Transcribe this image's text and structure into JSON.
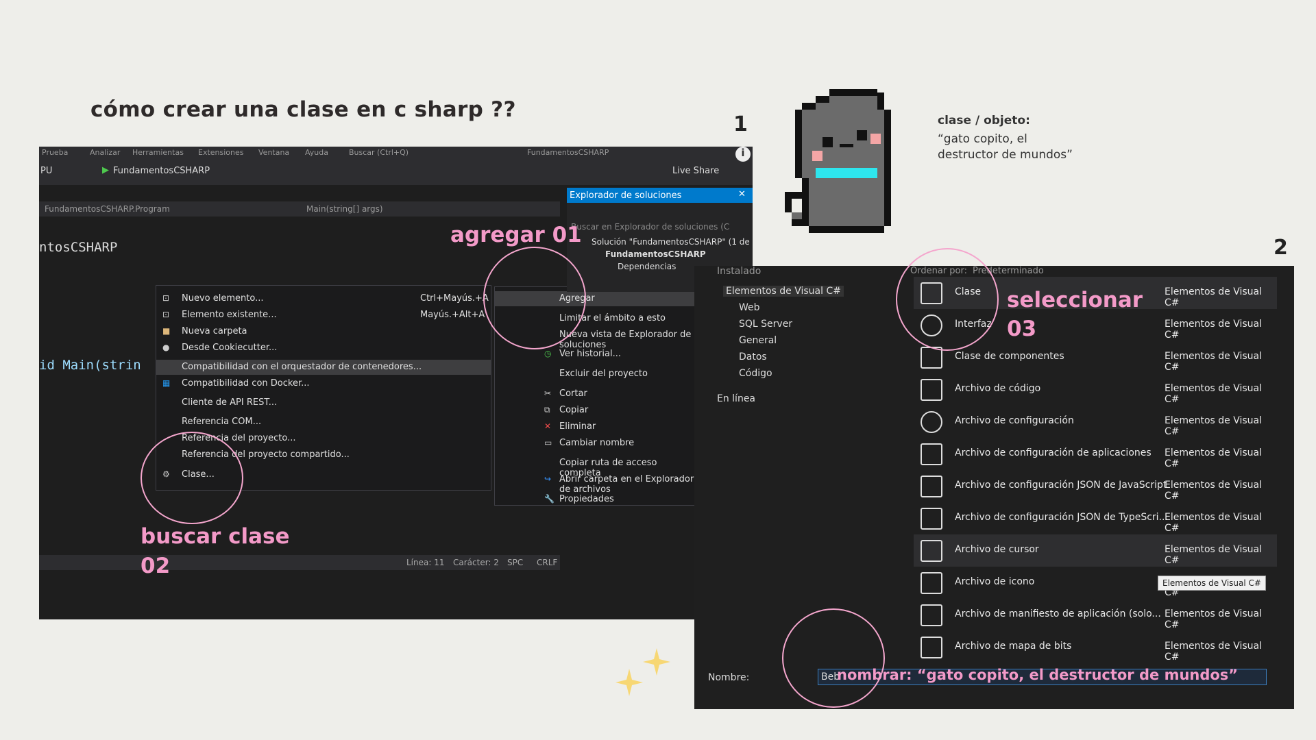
{
  "title": "cómo crear una clase en c sharp ??",
  "step1": "1",
  "step2": "2",
  "annotations": {
    "agregar": "agregar 01",
    "buscar_line1": "buscar clase",
    "buscar_line2": "02",
    "seleccionar_line1": "seleccionar",
    "seleccionar_line2": "03",
    "nombrar": "nombrar: “gato copito, el destructor de mundos”"
  },
  "note": {
    "heading": "clase / objeto:",
    "line1": "“gato copito, el",
    "line2": "destructor de mundos”"
  },
  "shot1": {
    "menu": [
      "Prueba",
      "Analizar",
      "Herramientas",
      "Extensiones",
      "Ventana",
      "Ayuda",
      "Buscar (Ctrl+Q)",
      "FundamentosCSHARP"
    ],
    "toolbar": {
      "cpu": "PU",
      "run_label": "FundamentosCSHARP",
      "live_share": "Live Share"
    },
    "nav_left": "FundamentosCSHARP.Program",
    "nav_right": "Main(string[] args)",
    "code_line1": "ntosCSHARP",
    "code_line2": "id Main(strin",
    "sub_menu": [
      {
        "label": "Nuevo elemento...",
        "shortcut": "Ctrl+Mayús.+A",
        "icon": "new-item-icon"
      },
      {
        "label": "Elemento existente...",
        "shortcut": "Mayús.+Alt+A",
        "icon": "existing-item-icon"
      },
      {
        "label": "Nueva carpeta",
        "shortcut": "",
        "icon": "folder-icon"
      },
      {
        "label": "Desde Cookiecutter...",
        "shortcut": "",
        "icon": "cookie-icon"
      },
      {
        "label": "Compatibilidad con el orquestador de contenedores...",
        "shortcut": "",
        "icon": ""
      },
      {
        "label": "Compatibilidad con Docker...",
        "shortcut": "",
        "icon": "docker-icon"
      },
      {
        "label": "Cliente de API REST...",
        "shortcut": "",
        "icon": ""
      },
      {
        "label": "Referencia COM...",
        "shortcut": "",
        "icon": ""
      },
      {
        "label": "Referencia del proyecto...",
        "shortcut": "",
        "icon": ""
      },
      {
        "label": "Referencia del proyecto compartido...",
        "shortcut": "",
        "icon": ""
      },
      {
        "label": "Clase...",
        "shortcut": "",
        "icon": "class-icon"
      }
    ],
    "ctx_menu": [
      "Agregar",
      "Limitar el ámbito a esto",
      "Nueva vista de Explorador de soluciones",
      "Ver historial...",
      "Excluir del proyecto",
      "Cortar",
      "Copiar",
      "Eliminar",
      "Cambiar nombre",
      "Copiar ruta de acceso completa",
      "Abrir carpeta en el Explorador de archivos",
      "Propiedades"
    ],
    "solution_explorer": {
      "title": "Explorador de soluciones",
      "search_placeholder": "Buscar en Explorador de soluciones (C",
      "solution": "Solución \"FundamentosCSHARP\" (1 de",
      "project": "FundamentosCSHARP",
      "deps": "Dependencias"
    },
    "status": {
      "line": "Línea: 11",
      "char": "Carácter: 2",
      "spc": "SPC",
      "crlf": "CRLF"
    }
  },
  "shot2": {
    "installed": "Instalado",
    "sort_label": "Ordenar por:",
    "sort_value": "Predeterminado",
    "tree": [
      "Elementos de Visual C#",
      "Web",
      "SQL Server",
      "General",
      "Datos",
      "Código",
      "En línea"
    ],
    "items": [
      {
        "name": "Clase",
        "category": "Elementos de Visual C#"
      },
      {
        "name": "Interfaz",
        "category": "Elementos de Visual C#"
      },
      {
        "name": "Clase de componentes",
        "category": "Elementos de Visual C#"
      },
      {
        "name": "Archivo de código",
        "category": "Elementos de Visual C#"
      },
      {
        "name": "Archivo de configuración",
        "category": "Elementos de Visual C#"
      },
      {
        "name": "Archivo de configuración de aplicaciones",
        "category": "Elementos de Visual C#"
      },
      {
        "name": "Archivo de configuración JSON de JavaScript",
        "category": "Elementos de Visual C#"
      },
      {
        "name": "Archivo de configuración JSON de TypeScri...",
        "category": "Elementos de Visual C#"
      },
      {
        "name": "Archivo de cursor",
        "category": "Elementos de Visual C#"
      },
      {
        "name": "Archivo de icono",
        "category": "Elementos de Visual C#"
      },
      {
        "name": "Archivo de manifiesto de aplicación (solo...",
        "category": "Elementos de Visual C#"
      },
      {
        "name": "Archivo de mapa de bits",
        "category": "Elementos de Visual C#"
      }
    ],
    "tooltip": "Elementos de Visual C#",
    "name_label": "Nombre:",
    "name_value": "Beb"
  }
}
